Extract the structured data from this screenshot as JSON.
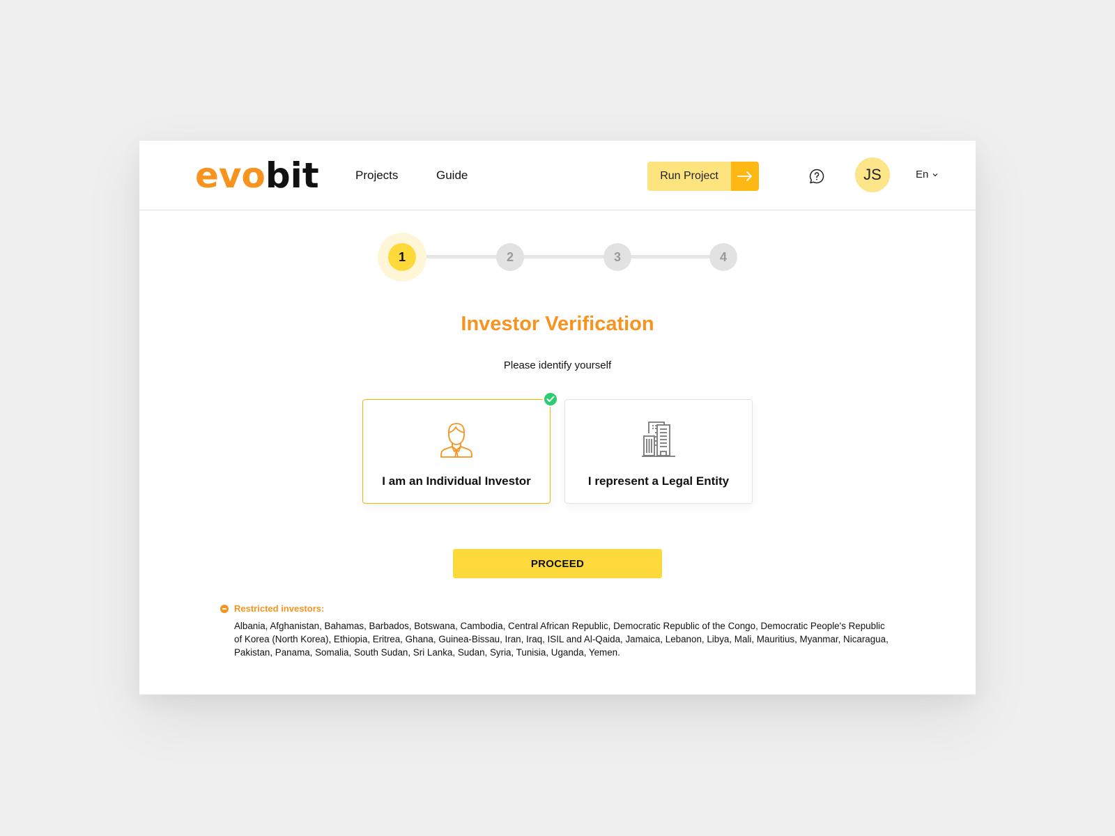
{
  "header": {
    "logo": {
      "part1": "evo",
      "part2": "bit"
    },
    "nav": [
      {
        "label": "Projects"
      },
      {
        "label": "Guide"
      }
    ],
    "run_project": {
      "label": "Run Project",
      "icon": "arrow-right-icon"
    },
    "help_icon": "help-chat-icon",
    "avatar": {
      "initials": "JS"
    },
    "language": {
      "selected": "En",
      "icon": "chevron-down-icon"
    }
  },
  "stepper": {
    "current_step": 1,
    "steps": [
      {
        "label": "1"
      },
      {
        "label": "2"
      },
      {
        "label": "3"
      },
      {
        "label": "4"
      }
    ]
  },
  "main": {
    "title": "Investor Verification",
    "subtitle": "Please identify yourself",
    "options": [
      {
        "label": "I am an Individual Investor",
        "icon": "person-icon",
        "selected": true
      },
      {
        "label": "I represent a Legal Entity",
        "icon": "building-icon",
        "selected": false
      }
    ],
    "proceed_label": "PROCEED"
  },
  "restricted": {
    "heading": "Restricted investors:",
    "countries": "Albania, Afghanistan, Bahamas, Barbados, Botswana, Cambodia, Central African Republic, Democratic Republic of the Congo, Democratic People's Republic of Korea (North Korea), Ethiopia, Eritrea, Ghana, Guinea-Bissau, Iran, Iraq, ISIL and Al-Qaida, Jamaica, Lebanon, Libya, Mali, Mauritius, Myanmar, Nicaragua, Pakistan, Panama, Somalia, South Sudan, Sri Lanka, Sudan, Syria, Tunisia, Uganda, Yemen."
  },
  "colors": {
    "brand_orange": "#f7931e",
    "accent_yellow": "#fdd93b",
    "success_green": "#2ecc71"
  }
}
